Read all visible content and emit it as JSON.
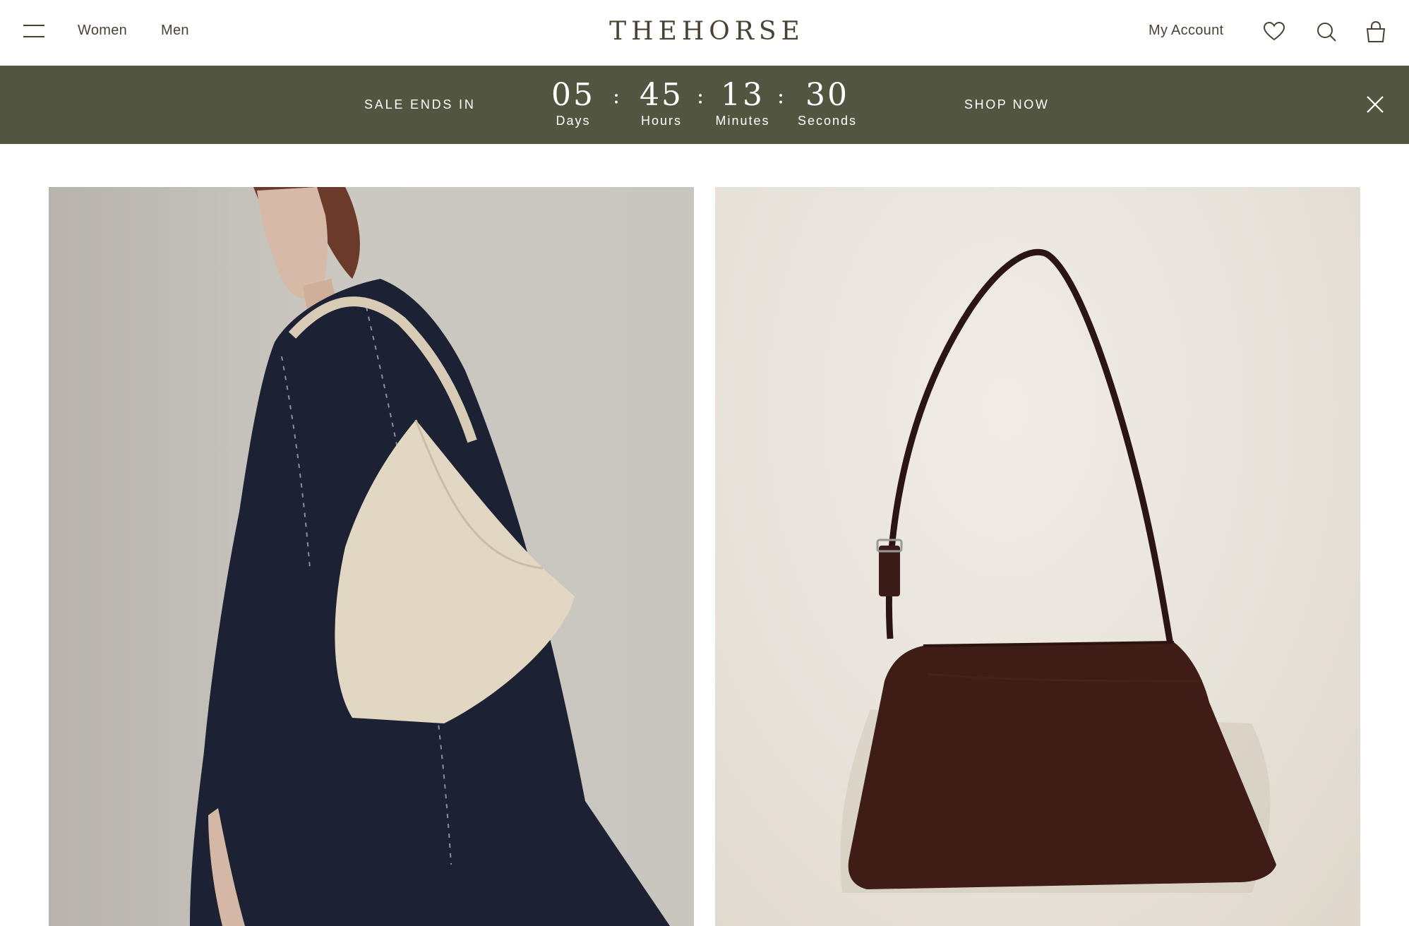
{
  "header": {
    "brand": "THEHORSE",
    "nav": [
      {
        "label": "Women"
      },
      {
        "label": "Men"
      }
    ],
    "account_label": "My Account",
    "icons": [
      "menu-icon",
      "heart-icon",
      "search-icon",
      "bag-icon"
    ]
  },
  "banner": {
    "label": "SALE ENDS IN",
    "countdown": {
      "days": {
        "value": "05",
        "label": "Days"
      },
      "hours": {
        "value": "45",
        "label": "Hours"
      },
      "minutes": {
        "value": "13",
        "label": "Minutes"
      },
      "seconds": {
        "value": "30",
        "label": "Seconds"
      }
    },
    "separator": ":",
    "cta": "SHOP NOW",
    "background_color": "#525640"
  },
  "products": [
    {
      "image": "model-wearing-cream-shoulder-bag"
    },
    {
      "image": "brown-leather-shoulder-bag"
    }
  ],
  "colors": {
    "text": "#4a4233",
    "banner": "#525640",
    "banner_text": "#ffffff"
  }
}
